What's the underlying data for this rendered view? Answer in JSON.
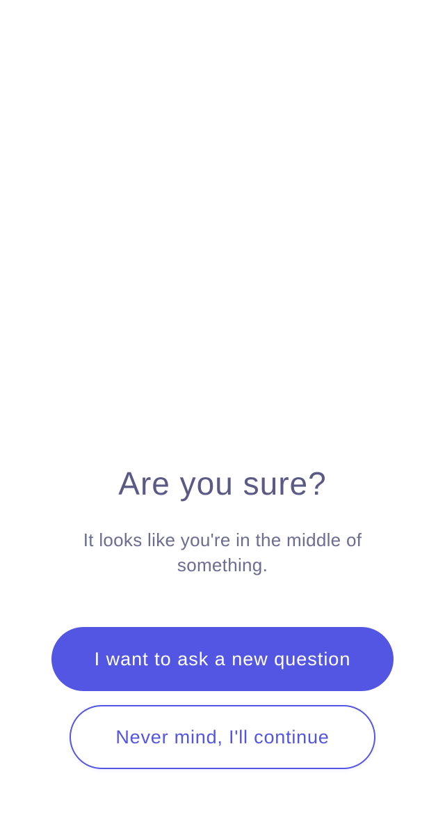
{
  "dialog": {
    "title": "Are you sure?",
    "message": "It looks like you're in the middle of something.",
    "primary_button_label": "I want to ask a new question",
    "secondary_button_label": "Never mind, I'll continue"
  },
  "colors": {
    "accent": "#5356e3",
    "title_text": "#5b5a86",
    "body_text": "#6d6c92",
    "background": "#ffffff"
  }
}
